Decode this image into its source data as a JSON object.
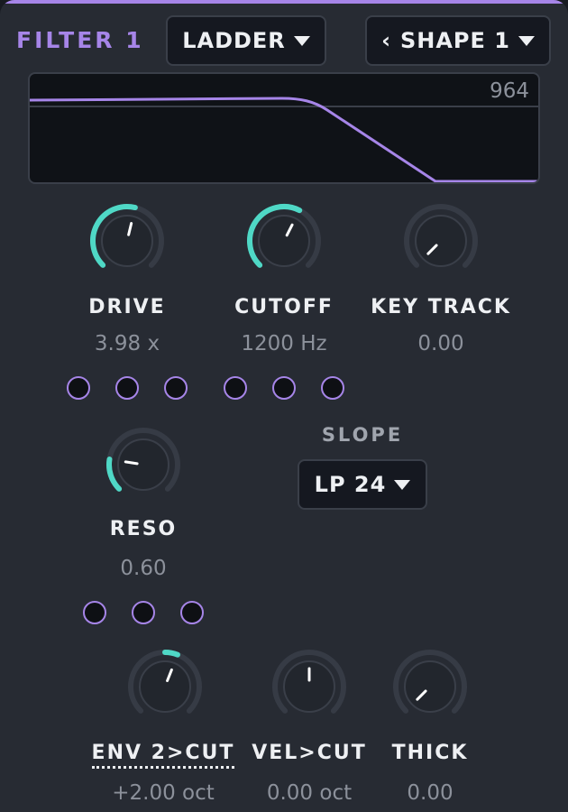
{
  "header": {
    "title": "FILTER 1",
    "filter_type": "LADDER",
    "shape_prev": "‹",
    "shape": "SHAPE 1"
  },
  "display": {
    "value": "964"
  },
  "knobs": {
    "drive": {
      "label": "DRIVE",
      "value": "3.98 x",
      "level": 0.55
    },
    "cutoff": {
      "label": "CUTOFF",
      "value": "1200 Hz",
      "level": 0.6
    },
    "key_track": {
      "label": "KEY TRACK",
      "value": "0.00",
      "level": 0.0
    },
    "reso": {
      "label": "RESO",
      "value": "0.60",
      "level": 0.2
    },
    "env2_cut": {
      "label": "ENV 2>CUT",
      "value": "+2.00 oct",
      "level": 0.58
    },
    "vel_cut": {
      "label": "VEL>CUT",
      "value": "0.00 oct",
      "level": 0.5
    },
    "thick": {
      "label": "THICK",
      "value": "0.00",
      "level": 0.0
    }
  },
  "slope": {
    "label": "SLOPE",
    "value": "LP 24"
  },
  "colors": {
    "accent": "#a685e8",
    "knob_arc": "#4fd8c6",
    "panel": "#272b33",
    "display_bg": "#0f1217"
  }
}
